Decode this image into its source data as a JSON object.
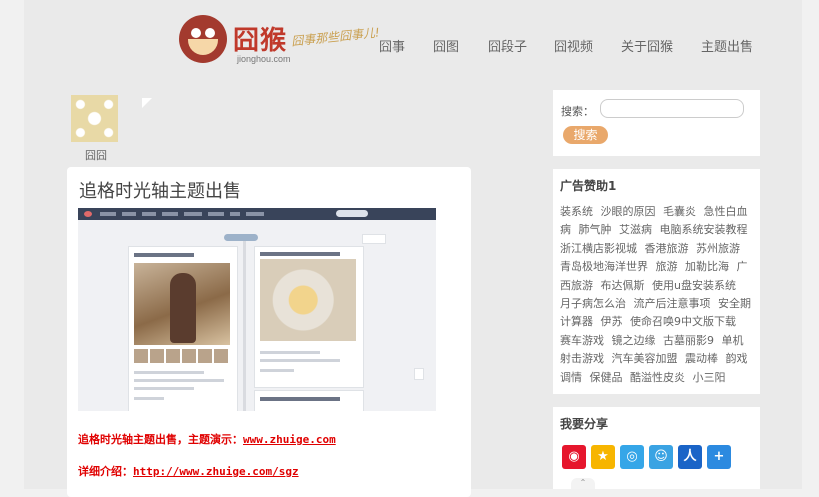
{
  "header": {
    "logo_text": "囧猴",
    "logo_domain": "jionghou.com",
    "logo_slogan": "囧事那些囧事儿!",
    "nav": [
      "囧事",
      "囧图",
      "囧段子",
      "囧视频",
      "关于囧猴",
      "主题出售"
    ]
  },
  "profile": {
    "name": "囧囧"
  },
  "post": {
    "title": "追格时光轴主题出售",
    "demo_prefix": "追格时光轴主题出售，主题演示：",
    "demo_url": "www.zhuige.com",
    "detail_prefix": "详细介绍：",
    "detail_url": "http://www.zhuige.com/sgz"
  },
  "sidebar": {
    "search_label": "搜索：",
    "search_placeholder": "",
    "search_button": "搜索",
    "ads_title": "广告赞助1",
    "ads": [
      "装系统",
      "沙眼的原因",
      "毛囊炎",
      "急性白血病",
      "肺气肿",
      "艾滋病",
      "电脑系统安装教程",
      "浙江横店影视城",
      "香港旅游",
      "苏州旅游",
      "青岛极地海洋世界",
      "旅游",
      "加勒比海",
      "广西旅游",
      "布达佩斯",
      "使用u盘安装系统",
      "月子病怎么治",
      "流产后注意事项",
      "安全期计算器",
      "伊苏",
      "使命召唤9中文版下载",
      "赛车游戏",
      "镜之边缘",
      "古墓丽影9",
      "单机射击游戏",
      "汽车美容加盟",
      "震动棒",
      "韵戏调情",
      "保健品",
      "酷溢性皮炎",
      "小三阳"
    ],
    "share_title": "我要分享",
    "share_icons": [
      "weibo-icon",
      "qzone-icon",
      "tencent-weibo-icon",
      "qq-icon",
      "renren-icon",
      "more-share-icon"
    ]
  }
}
